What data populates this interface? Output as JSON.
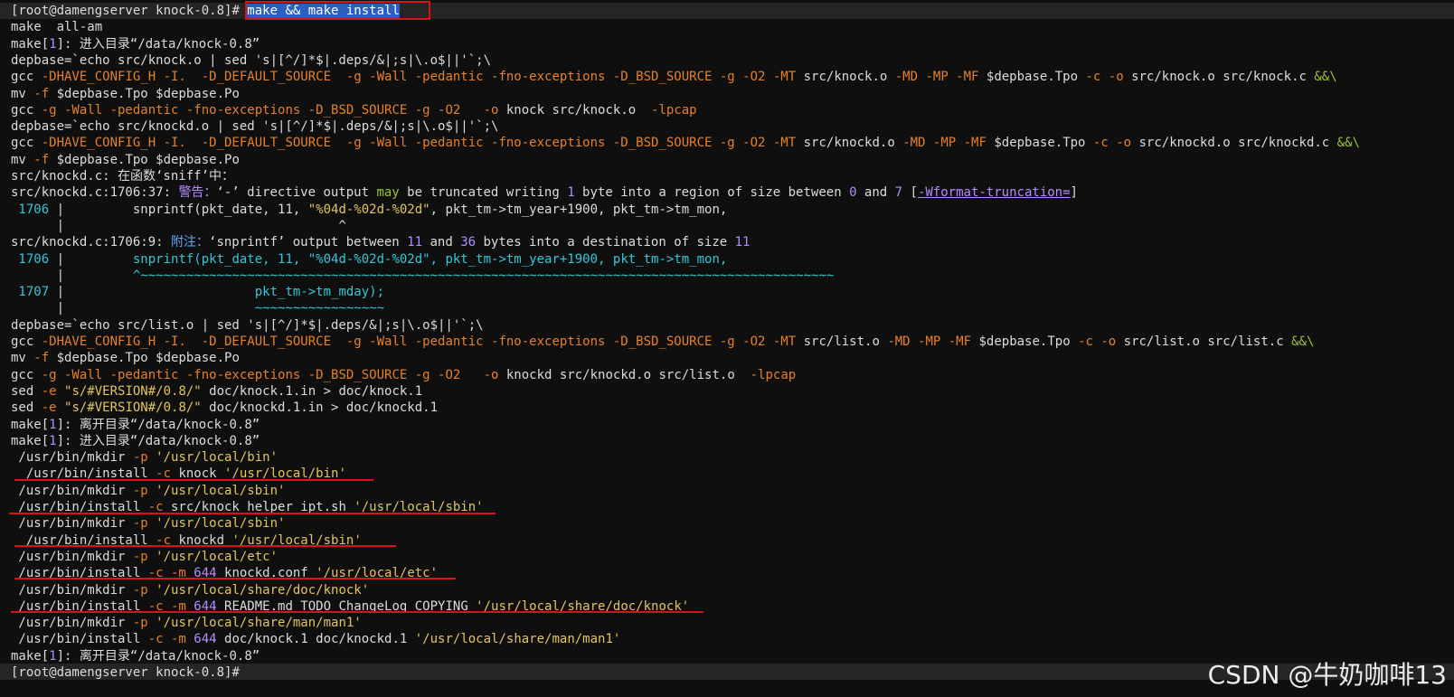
{
  "terminal": {
    "lines": [
      [
        {
          "t": "[root@damengserver knock-0.8]",
          "c": "normal"
        },
        {
          "t": "# ",
          "c": "normal"
        },
        {
          "t": "make && make install",
          "c": "sel"
        }
      ],
      [
        {
          "t": "make  all-am",
          "c": "normal"
        }
      ],
      [
        {
          "t": "make",
          "c": "normal"
        },
        {
          "t": "[",
          "c": "normal"
        },
        {
          "t": "1",
          "c": "num"
        },
        {
          "t": "]",
          "c": "normal"
        },
        {
          "t": ": 进入目录“/data/knock-0.8”",
          "c": "normal"
        }
      ],
      [
        {
          "t": "depbase=`echo src/knock.o | sed 's|[^/]*$|.deps/&|;s|\\.o$||'`;\\",
          "c": "normal"
        }
      ],
      [
        {
          "t": "gcc ",
          "c": "normal"
        },
        {
          "t": "-DHAVE_CONFIG_H -I.  -D_DEFAULT_SOURCE  -g -Wall -pedantic -fno-exceptions -D_BSD_SOURCE -g -O2 -MT",
          "c": "flag"
        },
        {
          "t": " src/knock.o ",
          "c": "normal"
        },
        {
          "t": "-MD -MP -MF",
          "c": "flag"
        },
        {
          "t": " $depbase.Tpo ",
          "c": "normal"
        },
        {
          "t": "-c -o",
          "c": "flag"
        },
        {
          "t": " src/knock.o src/knock.c ",
          "c": "normal"
        },
        {
          "t": "&&\\",
          "c": "green"
        }
      ],
      [
        {
          "t": "mv ",
          "c": "normal"
        },
        {
          "t": "-f",
          "c": "flag"
        },
        {
          "t": " $depbase.Tpo $depbase.Po",
          "c": "normal"
        }
      ],
      [
        {
          "t": "gcc ",
          "c": "normal"
        },
        {
          "t": "-g -Wall -pedantic -fno-exceptions -D_BSD_SOURCE -g -O2   -o",
          "c": "flag"
        },
        {
          "t": " knock src/knock.o  ",
          "c": "normal"
        },
        {
          "t": "-lpcap",
          "c": "flag"
        }
      ],
      [
        {
          "t": "depbase=`echo src/knockd.o | sed 's|[^/]*$|.deps/&|;s|\\.o$||'`;\\",
          "c": "normal"
        }
      ],
      [
        {
          "t": "gcc ",
          "c": "normal"
        },
        {
          "t": "-DHAVE_CONFIG_H -I.  -D_DEFAULT_SOURCE  -g -Wall -pedantic -fno-exceptions -D_BSD_SOURCE -g -O2 -MT",
          "c": "flag"
        },
        {
          "t": " src/knockd.o ",
          "c": "normal"
        },
        {
          "t": "-MD -MP -MF",
          "c": "flag"
        },
        {
          "t": " $depbase.Tpo ",
          "c": "normal"
        },
        {
          "t": "-c -o",
          "c": "flag"
        },
        {
          "t": " src/knockd.o src/knockd.c ",
          "c": "normal"
        },
        {
          "t": "&&\\",
          "c": "green"
        }
      ],
      [
        {
          "t": "mv ",
          "c": "normal"
        },
        {
          "t": "-f",
          "c": "flag"
        },
        {
          "t": " $depbase.Tpo $depbase.Po",
          "c": "normal"
        }
      ],
      [
        {
          "t": "src/knockd.c: 在函数‘sniff’中：",
          "c": "normal"
        }
      ],
      [
        {
          "t": "src/knockd.c:1706:37: ",
          "c": "normal"
        },
        {
          "t": "警告：",
          "c": "warn"
        },
        {
          "t": "‘-’ directive output ",
          "c": "normal"
        },
        {
          "t": "may",
          "c": "green"
        },
        {
          "t": " be truncated writing ",
          "c": "normal"
        },
        {
          "t": "1",
          "c": "num"
        },
        {
          "t": " byte into a region of size between ",
          "c": "normal"
        },
        {
          "t": "0",
          "c": "num"
        },
        {
          "t": " and ",
          "c": "normal"
        },
        {
          "t": "7",
          "c": "num"
        },
        {
          "t": " [",
          "c": "normal"
        },
        {
          "t": "-Wformat-truncation=",
          "c": "link"
        },
        {
          "t": "]",
          "c": "normal"
        }
      ],
      [
        {
          "t": " 1706 ",
          "c": "cyan"
        },
        {
          "t": "|         snprintf(pkt_date, 11, ",
          "c": "normal"
        },
        {
          "t": "\"%04d-%02d-%02d\"",
          "c": "str"
        },
        {
          "t": ", pkt_tm->tm_year+1900, pkt_tm->tm_mon,",
          "c": "normal"
        }
      ],
      [
        {
          "t": "      |                                    ^",
          "c": "normal"
        }
      ],
      [
        {
          "t": "src/knockd.c:1706:9: ",
          "c": "normal"
        },
        {
          "t": "附注：",
          "c": "note"
        },
        {
          "t": "‘snprintf’ output between ",
          "c": "normal"
        },
        {
          "t": "11",
          "c": "num"
        },
        {
          "t": " and ",
          "c": "normal"
        },
        {
          "t": "36",
          "c": "num"
        },
        {
          "t": " bytes into a destination of size ",
          "c": "normal"
        },
        {
          "t": "11",
          "c": "num"
        }
      ],
      [
        {
          "t": " 1706 ",
          "c": "cyan"
        },
        {
          "t": "|         ",
          "c": "normal"
        },
        {
          "t": "snprintf(pkt_date, 11, \"%04d-%02d-%02d\", pkt_tm->tm_year+1900, pkt_tm->tm_mon,",
          "c": "cyan"
        }
      ],
      [
        {
          "t": "      |         ",
          "c": "normal"
        },
        {
          "t": "^~~~~~~~~~~~~~~~~~~~~~~~~~~~~~~~~~~~~~~~~~~~~~~~~~~~~~~~~~~~~~~~~~~~~~~~~~~~~~~~~~~~~~~~~~~~",
          "c": "cyan"
        }
      ],
      [
        {
          "t": " 1707 ",
          "c": "cyan"
        },
        {
          "t": "|                         ",
          "c": "normal"
        },
        {
          "t": "pkt_tm->tm_mday);",
          "c": "cyan"
        }
      ],
      [
        {
          "t": "      |                         ",
          "c": "normal"
        },
        {
          "t": "~~~~~~~~~~~~~~~~~",
          "c": "cyan"
        }
      ],
      [
        {
          "t": "depbase=`echo src/list.o | sed 's|[^/]*$|.deps/&|;s|\\.o$||'`;\\",
          "c": "normal"
        }
      ],
      [
        {
          "t": "gcc ",
          "c": "normal"
        },
        {
          "t": "-DHAVE_CONFIG_H -I.  -D_DEFAULT_SOURCE  -g -Wall -pedantic -fno-exceptions -D_BSD_SOURCE -g -O2 -MT",
          "c": "flag"
        },
        {
          "t": " src/list.o ",
          "c": "normal"
        },
        {
          "t": "-MD -MP -MF",
          "c": "flag"
        },
        {
          "t": " $depbase.Tpo ",
          "c": "normal"
        },
        {
          "t": "-c -o",
          "c": "flag"
        },
        {
          "t": " src/list.o src/list.c ",
          "c": "normal"
        },
        {
          "t": "&&\\",
          "c": "green"
        }
      ],
      [
        {
          "t": "mv ",
          "c": "normal"
        },
        {
          "t": "-f",
          "c": "flag"
        },
        {
          "t": " $depbase.Tpo $depbase.Po",
          "c": "normal"
        }
      ],
      [
        {
          "t": "gcc ",
          "c": "normal"
        },
        {
          "t": "-g -Wall -pedantic -fno-exceptions -D_BSD_SOURCE -g -O2   -o",
          "c": "flag"
        },
        {
          "t": " knockd src/knockd.o src/list.o  ",
          "c": "normal"
        },
        {
          "t": "-lpcap",
          "c": "flag"
        }
      ],
      [
        {
          "t": "sed ",
          "c": "normal"
        },
        {
          "t": "-e ",
          "c": "flag"
        },
        {
          "t": "\"s/#VERSION#/0.8/\"",
          "c": "str"
        },
        {
          "t": " doc/knock.1.in > doc/knock.1",
          "c": "normal"
        }
      ],
      [
        {
          "t": "sed ",
          "c": "normal"
        },
        {
          "t": "-e ",
          "c": "flag"
        },
        {
          "t": "\"s/#VERSION#/0.8/\"",
          "c": "str"
        },
        {
          "t": " doc/knockd.1.in > doc/knockd.1",
          "c": "normal"
        }
      ],
      [
        {
          "t": "make",
          "c": "normal"
        },
        {
          "t": "[",
          "c": "normal"
        },
        {
          "t": "1",
          "c": "num"
        },
        {
          "t": "]",
          "c": "normal"
        },
        {
          "t": ": 离开目录“/data/knock-0.8”",
          "c": "normal"
        }
      ],
      [
        {
          "t": "make",
          "c": "normal"
        },
        {
          "t": "[",
          "c": "normal"
        },
        {
          "t": "1",
          "c": "num"
        },
        {
          "t": "]",
          "c": "normal"
        },
        {
          "t": ": 进入目录“/data/knock-0.8”",
          "c": "normal"
        }
      ],
      [
        {
          "t": " /usr/bin/mkdir ",
          "c": "normal"
        },
        {
          "t": "-p ",
          "c": "flag"
        },
        {
          "t": "'/usr/local/bin'",
          "c": "str"
        }
      ],
      [
        {
          "t": "  /usr/bin/install ",
          "c": "normal"
        },
        {
          "t": "-c",
          "c": "flag"
        },
        {
          "t": " knock ",
          "c": "normal"
        },
        {
          "t": "'/usr/local/bin'",
          "c": "str"
        }
      ],
      [
        {
          "t": " /usr/bin/mkdir ",
          "c": "normal"
        },
        {
          "t": "-p ",
          "c": "flag"
        },
        {
          "t": "'/usr/local/sbin'",
          "c": "str"
        }
      ],
      [
        {
          "t": " /usr/bin/install ",
          "c": "normal"
        },
        {
          "t": "-c",
          "c": "flag"
        },
        {
          "t": " src/knock_helper_ipt.sh ",
          "c": "normal"
        },
        {
          "t": "'/usr/local/sbin'",
          "c": "str"
        }
      ],
      [
        {
          "t": " /usr/bin/mkdir ",
          "c": "normal"
        },
        {
          "t": "-p ",
          "c": "flag"
        },
        {
          "t": "'/usr/local/sbin'",
          "c": "str"
        }
      ],
      [
        {
          "t": "  /usr/bin/install ",
          "c": "normal"
        },
        {
          "t": "-c",
          "c": "flag"
        },
        {
          "t": " knockd ",
          "c": "normal"
        },
        {
          "t": "'/usr/local/sbin'",
          "c": "str"
        }
      ],
      [
        {
          "t": " /usr/bin/mkdir ",
          "c": "normal"
        },
        {
          "t": "-p ",
          "c": "flag"
        },
        {
          "t": "'/usr/local/etc'",
          "c": "str"
        }
      ],
      [
        {
          "t": " /usr/bin/install ",
          "c": "normal"
        },
        {
          "t": "-c -m ",
          "c": "flag"
        },
        {
          "t": "644",
          "c": "num"
        },
        {
          "t": " knockd.conf ",
          "c": "normal"
        },
        {
          "t": "'/usr/local/etc'",
          "c": "str"
        }
      ],
      [
        {
          "t": " /usr/bin/mkdir ",
          "c": "normal"
        },
        {
          "t": "-p ",
          "c": "flag"
        },
        {
          "t": "'/usr/local/share/doc/knock'",
          "c": "str"
        }
      ],
      [
        {
          "t": " /usr/bin/install ",
          "c": "normal"
        },
        {
          "t": "-c -m ",
          "c": "flag"
        },
        {
          "t": "644",
          "c": "num"
        },
        {
          "t": " README.md TODO ChangeLog COPYING ",
          "c": "normal"
        },
        {
          "t": "'/usr/local/share/doc/knock'",
          "c": "str"
        }
      ],
      [
        {
          "t": " /usr/bin/mkdir ",
          "c": "normal"
        },
        {
          "t": "-p ",
          "c": "flag"
        },
        {
          "t": "'/usr/local/share/man/man1'",
          "c": "str"
        }
      ],
      [
        {
          "t": " /usr/bin/install ",
          "c": "normal"
        },
        {
          "t": "-c -m ",
          "c": "flag"
        },
        {
          "t": "644",
          "c": "num"
        },
        {
          "t": " doc/knock.1 doc/knockd.1 ",
          "c": "normal"
        },
        {
          "t": "'/usr/local/share/man/man1'",
          "c": "str"
        }
      ],
      [
        {
          "t": "make",
          "c": "normal"
        },
        {
          "t": "[",
          "c": "normal"
        },
        {
          "t": "1",
          "c": "num"
        },
        {
          "t": "]",
          "c": "normal"
        },
        {
          "t": ": 离开目录“/data/knock-0.8”",
          "c": "normal"
        }
      ],
      [
        {
          "t": "[root@damengserver knock-0.8]",
          "c": "normal"
        },
        {
          "t": "#",
          "c": "normal"
        }
      ]
    ]
  },
  "watermark": "CSDN @牛奶咖啡13",
  "colors": {
    "background": "#0f0f0f",
    "text": "#dcdcdc",
    "flag": "#e5802b",
    "string": "#e3c45f",
    "number": "#b48cff",
    "annotation": "#d9121a"
  }
}
